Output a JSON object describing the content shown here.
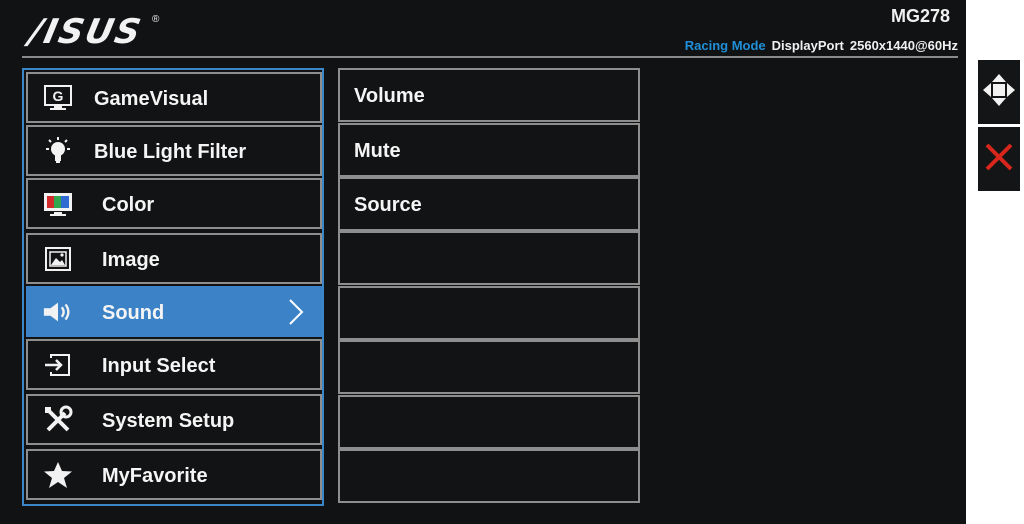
{
  "header": {
    "logo_text": "/ISUS",
    "logo_mark": "®",
    "model": "MG278",
    "status": {
      "mode": "Racing Mode",
      "input": "DisplayPort",
      "resolution": "2560x1440@60Hz"
    }
  },
  "main_menu": {
    "selected_index": 4,
    "items": [
      {
        "label": "GameVisual",
        "icon": "gamevisual-icon"
      },
      {
        "label": "Blue Light Filter",
        "icon": "bulb-icon"
      },
      {
        "label": "Color",
        "icon": "color-icon"
      },
      {
        "label": "Image",
        "icon": "image-icon"
      },
      {
        "label": "Sound",
        "icon": "speaker-icon"
      },
      {
        "label": "Input Select",
        "icon": "input-select-icon"
      },
      {
        "label": "System Setup",
        "icon": "tools-icon"
      },
      {
        "label": "MyFavorite",
        "icon": "star-icon"
      }
    ]
  },
  "sub_menu": {
    "items": [
      {
        "label": "Volume"
      },
      {
        "label": "Mute"
      },
      {
        "label": "Source"
      },
      {
        "label": ""
      },
      {
        "label": ""
      },
      {
        "label": ""
      },
      {
        "label": ""
      },
      {
        "label": ""
      }
    ]
  },
  "side_controls": {
    "navigate_icon": "four-way-arrow-icon",
    "close_icon": "close-icon",
    "close_color": "#d9261c"
  },
  "colors": {
    "accent_blue": "#3b82c6",
    "mode_blue": "#1e8fd8"
  }
}
